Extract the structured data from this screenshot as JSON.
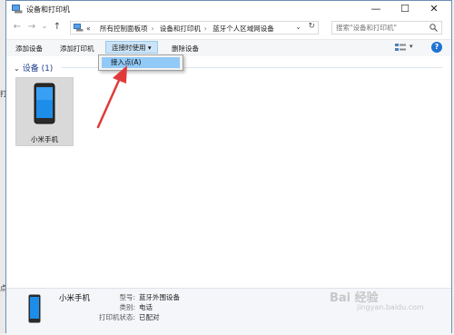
{
  "window": {
    "title": "设备和打印机"
  },
  "nav": {
    "back_icon": "←",
    "forward_icon": "→",
    "down_icon": "⌄",
    "up_icon": "↑",
    "crumbs": [
      "«",
      "所有控制面板项",
      "设备和打印机",
      "蓝牙个人区域网设备"
    ],
    "search_placeholder": "搜索\"设备和打印机\""
  },
  "toolbar": {
    "add_device": "添加设备",
    "add_printer": "添加打印机",
    "connect_using": "连接时使用 ▾",
    "remove_device": "删除设备",
    "help": "?"
  },
  "menu": {
    "item": "接入点(A)"
  },
  "group": {
    "label": "设备 (1)"
  },
  "device": {
    "name": "小米手机"
  },
  "details": {
    "name": "小米手机",
    "model_label": "型号:",
    "model_value": "蓝牙外围设备",
    "category_label": "类别:",
    "category_value": "电话",
    "printer_label": "打印机状态:",
    "printer_value": "已配对"
  },
  "behind_chars": [
    "打",
    "点"
  ],
  "watermark": {
    "text": "Bai 经验",
    "sub": "jingyan.baidu.com"
  },
  "colors": {
    "accent": "#1e73d2",
    "selection": "#cce4f7",
    "menu_highlight": "#91c9f7",
    "arrow": "#e03a3a"
  }
}
